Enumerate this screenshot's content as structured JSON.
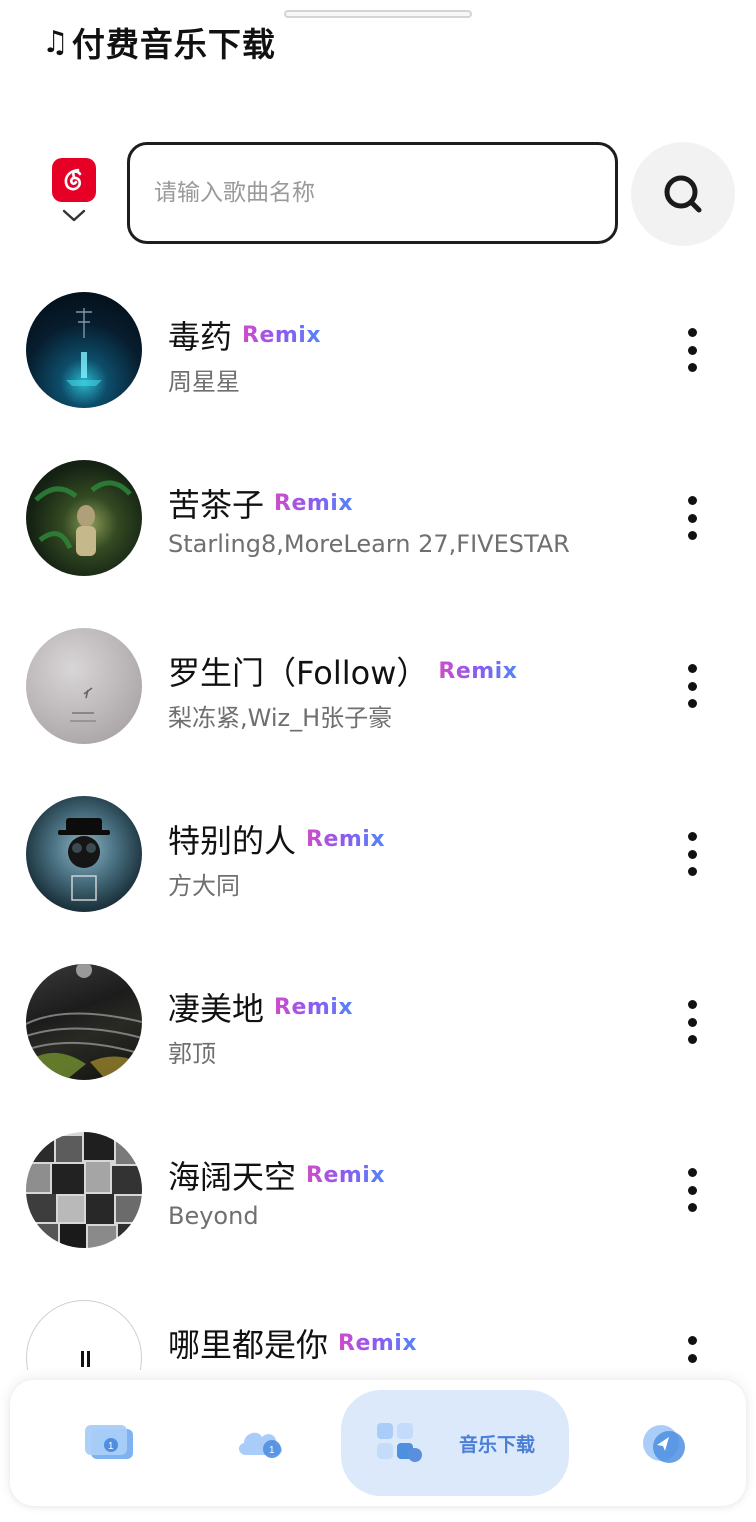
{
  "header": {
    "title_icon": "♫",
    "title": "付费音乐下载"
  },
  "search": {
    "source_icon": "netease-cloud-music-logo",
    "placeholder": "请输入歌曲名称",
    "value": "",
    "button_icon": "search-icon"
  },
  "remix_label": "Remix",
  "songs": [
    {
      "title": "毒药",
      "artist": "周星星",
      "cover": "dark-blue-stage"
    },
    {
      "title": "苦茶子",
      "artist": "Starling8,MoreLearn 27,FIVESTAR",
      "cover": "jungle-figure"
    },
    {
      "title": "罗生门（Follow）",
      "artist": "梨冻紧,Wiz_H张子豪",
      "cover": "grey-sky"
    },
    {
      "title": "特别的人",
      "artist": "方大同",
      "cover": "gas-mask-portrait"
    },
    {
      "title": "凄美地",
      "artist": "郭顶",
      "cover": "dark-landscape"
    },
    {
      "title": "海阔天空",
      "artist": "Beyond",
      "cover": "photo-collage"
    },
    {
      "title": "哪里都是你",
      "artist": "",
      "cover": "white-pause"
    }
  ],
  "bottom_nav": {
    "items": [
      {
        "icon": "ticket-icon"
      },
      {
        "icon": "cloud-icon"
      },
      {
        "icon": "grid-apps-icon",
        "label": "音乐下载",
        "active": true
      },
      {
        "icon": "send-icon"
      }
    ]
  },
  "colors": {
    "accent": "#4b7fd6",
    "active_tab_bg": "#dce9fb",
    "remix_gradient": [
      "#d24bc9",
      "#8a5cf0",
      "#4f86f7"
    ],
    "netease_red": "#e60026"
  }
}
